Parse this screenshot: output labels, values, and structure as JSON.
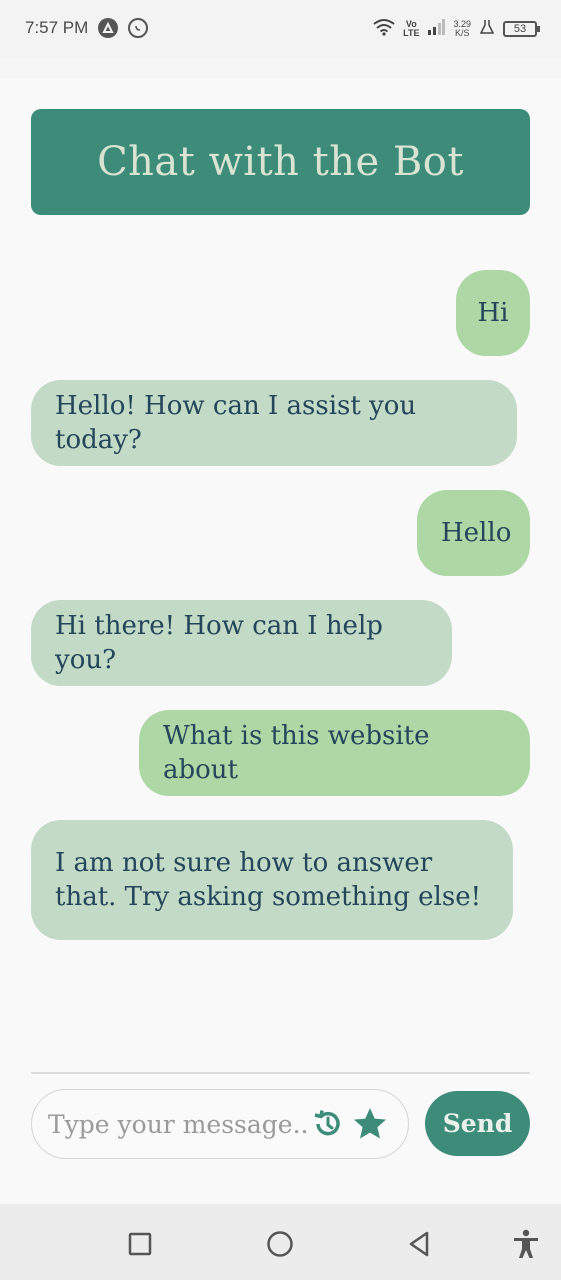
{
  "status_bar": {
    "time": "7:57 PM",
    "volte_top": "Vo",
    "volte_bottom": "LTE",
    "speed_value": "3.29",
    "speed_unit": "K/S",
    "battery": "53"
  },
  "header": {
    "title": "Chat with the Bot"
  },
  "messages": [
    {
      "sender": "user",
      "text": "Hi"
    },
    {
      "sender": "bot",
      "text": "Hello! How can I assist you today?"
    },
    {
      "sender": "user",
      "text": "Hello"
    },
    {
      "sender": "bot",
      "text": "Hi there! How can I help you?"
    },
    {
      "sender": "user",
      "text": "What is this website about"
    },
    {
      "sender": "bot",
      "text": "I am not sure how to answer that. Try asking something else!"
    }
  ],
  "composer": {
    "placeholder": "Type your message...",
    "value": "",
    "history_icon": "history-icon",
    "favorite_icon": "star-icon",
    "send_label": "Send"
  },
  "colors": {
    "accent": "#3d8c79",
    "user_bubble": "#aed7a6",
    "bot_bubble": "#c2dac6",
    "message_text": "#23465a"
  }
}
